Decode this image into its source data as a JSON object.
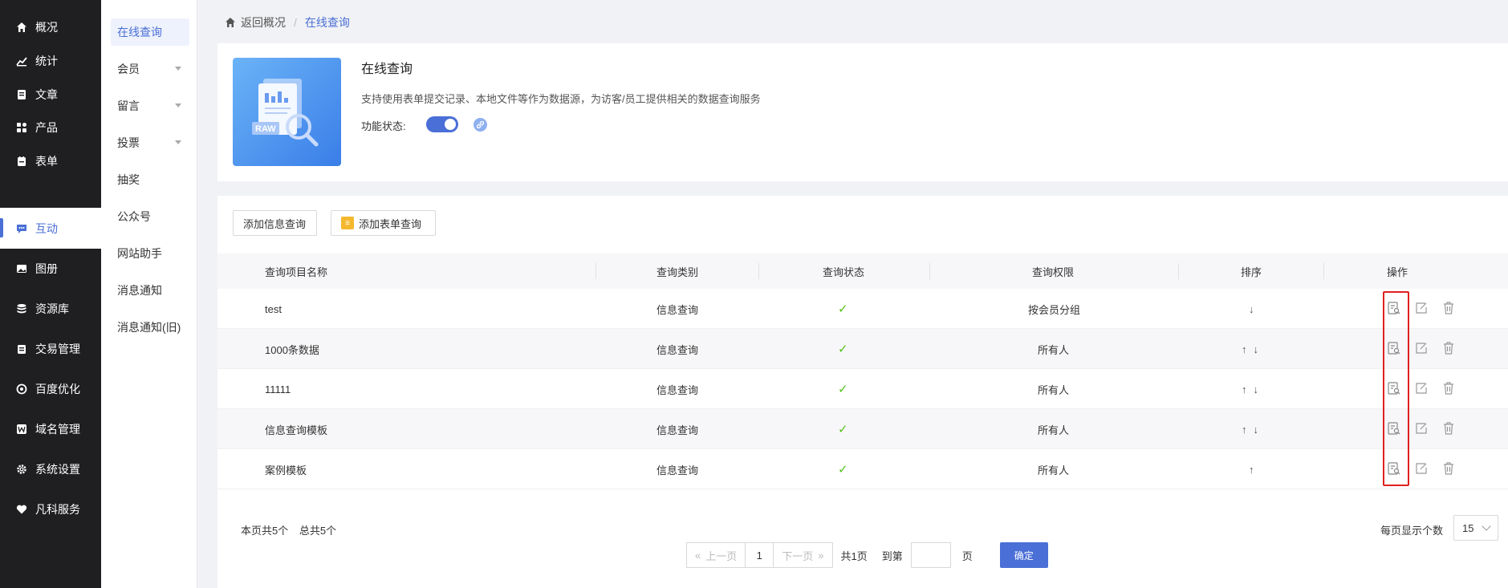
{
  "nav": {
    "items": [
      {
        "label": "概况",
        "icon": "home-icon"
      },
      {
        "label": "统计",
        "icon": "stats-icon"
      },
      {
        "label": "文章",
        "icon": "article-icon"
      },
      {
        "label": "产品",
        "icon": "product-icon"
      },
      {
        "label": "表单",
        "icon": "form-icon"
      },
      {
        "label": "互动",
        "icon": "interact-icon",
        "active": true
      },
      {
        "label": "图册",
        "icon": "album-icon"
      },
      {
        "label": "资源库",
        "icon": "database-icon"
      },
      {
        "label": "交易管理",
        "icon": "trade-icon"
      },
      {
        "label": "百度优化",
        "icon": "seo-icon"
      },
      {
        "label": "域名管理",
        "icon": "domain-icon"
      },
      {
        "label": "系统设置",
        "icon": "gear-icon"
      },
      {
        "label": "凡科服务",
        "icon": "heart-icon"
      }
    ]
  },
  "subnav": {
    "items": [
      {
        "label": "在线查询",
        "active": true
      },
      {
        "label": "会员",
        "has_caret": true
      },
      {
        "label": "留言",
        "has_caret": true
      },
      {
        "label": "投票",
        "has_caret": true
      },
      {
        "label": "抽奖"
      },
      {
        "label": "公众号"
      },
      {
        "label": "网站助手"
      },
      {
        "label": "消息通知"
      },
      {
        "label": "消息通知(旧)"
      }
    ]
  },
  "breadcrumb": {
    "back": "返回概况",
    "sep": "/",
    "current": "在线查询"
  },
  "header": {
    "title": "在线查询",
    "description": "支持使用表单提交记录、本地文件等作为数据源，为访客/员工提供相关的数据查询服务",
    "status_label": "功能状态:",
    "status_on": true,
    "hero_badge": "RAW"
  },
  "toolbar": {
    "add_info_query": "添加信息查询",
    "add_form_query": "添加表单查询"
  },
  "table": {
    "headers": [
      "查询项目名称",
      "查询类别",
      "查询状态",
      "查询权限",
      "排序",
      "操作"
    ],
    "rows": [
      {
        "name": "test",
        "category": "信息查询",
        "status": "✓",
        "permission": "按会员分组",
        "sort": [
          "↓"
        ]
      },
      {
        "name": "1000条数据",
        "category": "信息查询",
        "status": "✓",
        "permission": "所有人",
        "sort": [
          "↑",
          "↓"
        ]
      },
      {
        "name": "11111",
        "category": "信息查询",
        "status": "✓",
        "permission": "所有人",
        "sort": [
          "↑",
          "↓"
        ]
      },
      {
        "name": "信息查询模板",
        "category": "信息查询",
        "status": "✓",
        "permission": "所有人",
        "sort": [
          "↑",
          "↓"
        ]
      },
      {
        "name": "案例模板",
        "category": "信息查询",
        "status": "✓",
        "permission": "所有人",
        "sort": [
          "↑"
        ]
      }
    ]
  },
  "footer": {
    "page_count": "本页共5个",
    "total_count": "总共5个",
    "prev": "上一页",
    "next": "下一页",
    "current_page": "1",
    "total_pages": "共1页",
    "goto": "到第",
    "page_unit": "页",
    "confirm": "确定",
    "per_page_label": "每页显示个数",
    "per_page_value": "15"
  },
  "colors": {
    "accent": "#4a6fd6",
    "nav_bg": "#1f1f22",
    "check": "#52c41a",
    "highlight": "#e02020"
  }
}
